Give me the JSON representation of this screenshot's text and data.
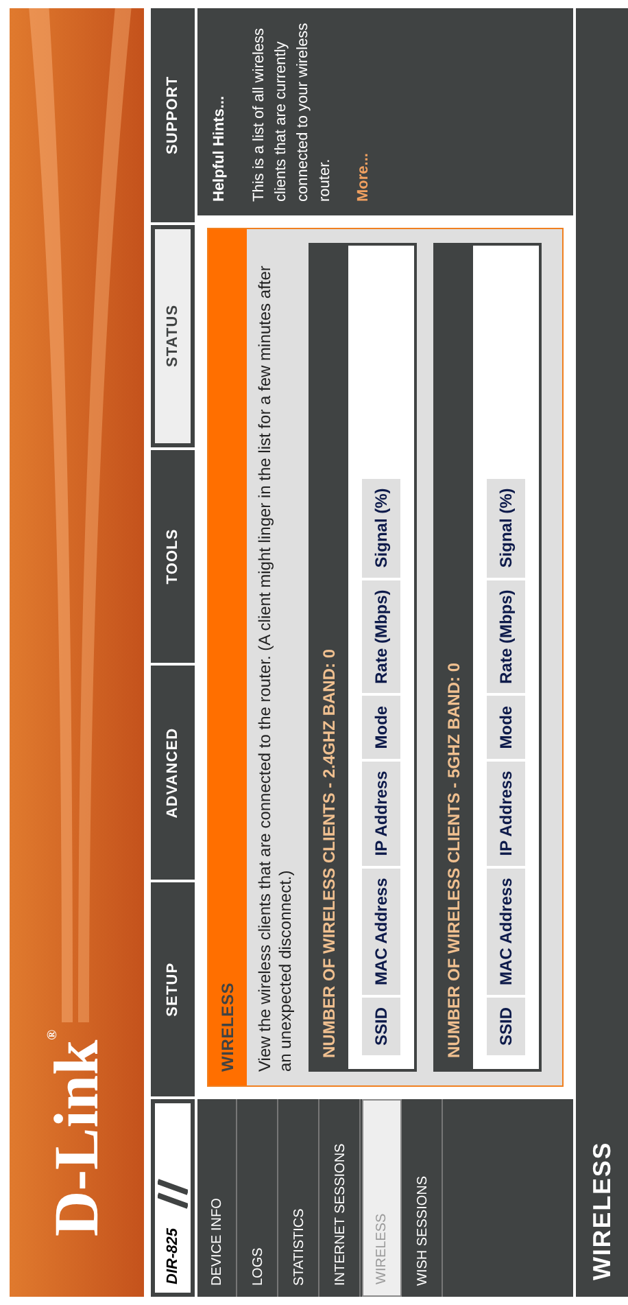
{
  "banner": {
    "logo": "D-Link",
    "logo_mark": "®"
  },
  "model": "DIR-825",
  "tabs": [
    {
      "label": "SETUP",
      "selected": false
    },
    {
      "label": "ADVANCED",
      "selected": false
    },
    {
      "label": "TOOLS",
      "selected": false
    },
    {
      "label": "STATUS",
      "selected": true
    },
    {
      "label": "SUPPORT",
      "selected": false
    }
  ],
  "sidebar": {
    "items": [
      {
        "label": "DEVICE INFO",
        "selected": false
      },
      {
        "label": "LOGS",
        "selected": false
      },
      {
        "label": "STATISTICS",
        "selected": false
      },
      {
        "label": "INTERNET SESSIONS",
        "selected": false
      },
      {
        "label": "WIRELESS",
        "selected": true
      },
      {
        "label": "WISH SESSIONS",
        "selected": false
      }
    ]
  },
  "main": {
    "title": "WIRELESS",
    "description": "View the wireless clients that are connected to the router. (A client might linger in the list for a few minutes after an unexpected disconnect.)",
    "sections": [
      {
        "title": "NUMBER OF WIRELESS CLIENTS - 2.4GHZ BAND: 0",
        "columns": [
          "SSID",
          "MAC Address",
          "IP Address",
          "Mode",
          "Rate (Mbps)",
          "Signal (%)"
        ]
      },
      {
        "title": "NUMBER OF WIRELESS CLIENTS - 5GHZ BAND: 0",
        "columns": [
          "SSID",
          "MAC Address",
          "IP Address",
          "Mode",
          "Rate (Mbps)",
          "Signal (%)"
        ]
      }
    ]
  },
  "hints": {
    "title": "Helpful Hints...",
    "text": "This is a list of all wireless clients that are currently connected to your wireless router.",
    "more": "More..."
  },
  "footer": {
    "label": "WIRELESS"
  }
}
